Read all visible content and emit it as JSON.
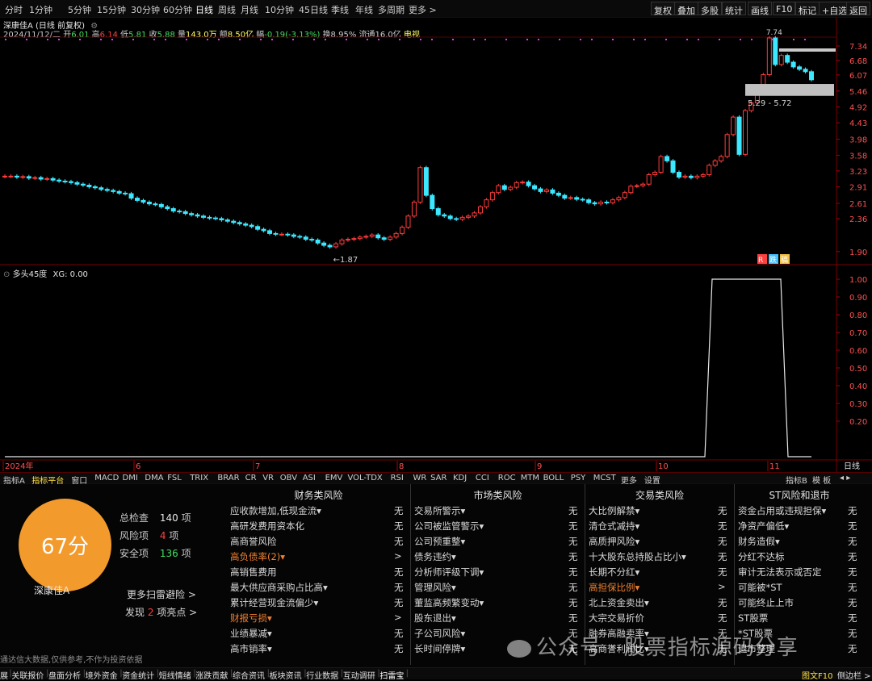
{
  "toolbar": {
    "timeframes": [
      "分时",
      "1分钟",
      "5分钟",
      "15分钟",
      "30分钟",
      "60分钟",
      "日线",
      "周线",
      "月线",
      "10分钟",
      "45日线",
      "季线",
      "年线",
      "多周期",
      "更多 >"
    ],
    "right_buttons": [
      "复权",
      "叠加",
      "多股",
      "统计",
      "画线",
      "F10",
      "标记",
      "+自选",
      "返回"
    ]
  },
  "info": {
    "name": "深康佳A (日线 前复权)",
    "date": "2024/11/12/二",
    "open_label": "开",
    "open": "6.01",
    "high_label": "高",
    "high": "6.14",
    "low_label": "低",
    "low": "5.81",
    "close_label": "收",
    "close": "5.88",
    "volume_label": "量",
    "volume": "143.0万",
    "amount_label": "额",
    "amount": "8.50亿",
    "change_label": "幅",
    "change": "-0.19(-3.13%)",
    "turnover_label": "换",
    "turnover": "8.95%",
    "float_label": "流通",
    "float": "16.0亿",
    "sector": "电视"
  },
  "price_axis": [
    "7.34",
    "6.68",
    "6.07",
    "5.46",
    "4.92",
    "4.43",
    "3.98",
    "3.58",
    "3.23",
    "2.91",
    "2.61",
    "2.36",
    "1.90"
  ],
  "annotations": {
    "low_price": "1.87",
    "high_price": "7.74",
    "range": "5.29 - 5.72",
    "tags": [
      "R",
      "跌",
      "稿"
    ]
  },
  "indicator": {
    "title": "多头45度",
    "value": "XG: 0.00",
    "axis": [
      "1.00",
      "0.90",
      "0.80",
      "0.70",
      "0.60",
      "0.50",
      "0.40",
      "0.30",
      "0.20"
    ]
  },
  "time_axis": {
    "labels": [
      "2024年",
      "6",
      "7",
      "8",
      "9",
      "10",
      "11"
    ],
    "right_label": "日线"
  },
  "indicator_tabs": [
    "指标A",
    "指标平台",
    "窗口",
    "MACD",
    "DMI",
    "DMA",
    "FSL",
    "TRIX",
    "BRAR",
    "CR",
    "VR",
    "OBV",
    "ASI",
    "EMV",
    "VOL-TDX",
    "RSI",
    "WR",
    "SAR",
    "KDJ",
    "CCI",
    "ROC",
    "MTM",
    "BOLL",
    "PSY",
    "MCST",
    "更多",
    "设置"
  ],
  "indicator_tabs_right": [
    "指标B",
    "模 板"
  ],
  "scan": {
    "score": "67分",
    "stock_name": "深康佳A",
    "total_label": "总检查",
    "total": "140",
    "total_unit": "项",
    "risk_label": "风险项",
    "risk": "4",
    "risk_unit": "项",
    "safe_label": "安全项",
    "safe": "136",
    "safe_unit": "项",
    "more_link": "更多扫雷避险 >",
    "found_prefix": "发现",
    "found": "2",
    "found_suffix": "项亮点 >",
    "disclaimer": "通达信大数据,仅供参考,不作为投资依据"
  },
  "categories": [
    {
      "title": "财务类风险",
      "rows": [
        {
          "label": "应收款增加,低现金流▾",
          "value": "无",
          "hl": false
        },
        {
          "label": "高研发费用资本化",
          "value": "无",
          "hl": false
        },
        {
          "label": "高商誉风险",
          "value": "无",
          "hl": false
        },
        {
          "label": "高负债率(2)▾",
          "value": ">",
          "hl": true
        },
        {
          "label": "高销售费用",
          "value": "无",
          "hl": false
        },
        {
          "label": "最大供应商采购占比高▾",
          "value": "无",
          "hl": false
        },
        {
          "label": "累计经营现金流偏少▾",
          "value": "无",
          "hl": false
        },
        {
          "label": "财报亏损▾",
          "value": ">",
          "hl": true
        },
        {
          "label": "业绩暴减▾",
          "value": "无",
          "hl": false
        },
        {
          "label": "高市销率▾",
          "value": "无",
          "hl": false
        }
      ]
    },
    {
      "title": "市场类风险",
      "rows": [
        {
          "label": "交易所警示▾",
          "value": "无",
          "hl": false
        },
        {
          "label": "公司被监管警示▾",
          "value": "无",
          "hl": false
        },
        {
          "label": "公司预重整▾",
          "value": "无",
          "hl": false
        },
        {
          "label": "债务违约▾",
          "value": "无",
          "hl": false
        },
        {
          "label": "分析师评级下调▾",
          "value": "无",
          "hl": false
        },
        {
          "label": "管理风险▾",
          "value": "无",
          "hl": false
        },
        {
          "label": "董监高频繁变动▾",
          "value": "无",
          "hl": false
        },
        {
          "label": "股东退出▾",
          "value": "无",
          "hl": false
        },
        {
          "label": "子公司风险▾",
          "value": "无",
          "hl": false
        },
        {
          "label": "长时间停牌▾",
          "value": "无",
          "hl": false
        }
      ]
    },
    {
      "title": "交易类风险",
      "rows": [
        {
          "label": "大比例解禁▾",
          "value": "无",
          "hl": false
        },
        {
          "label": "清仓式减持▾",
          "value": "无",
          "hl": false
        },
        {
          "label": "高质押风险▾",
          "value": "无",
          "hl": false
        },
        {
          "label": "十大股东总持股占比小▾",
          "value": "无",
          "hl": false
        },
        {
          "label": "长期不分红▾",
          "value": "无",
          "hl": false
        },
        {
          "label": "高担保比例▾",
          "value": ">",
          "hl": true
        },
        {
          "label": "北上资金卖出▾",
          "value": "无",
          "hl": false
        },
        {
          "label": "大宗交易折价",
          "value": "无",
          "hl": false
        },
        {
          "label": "融券高融卖率▾",
          "value": "无",
          "hl": false
        },
        {
          "label": "高商誉利润比▾",
          "value": "无",
          "hl": false
        }
      ]
    },
    {
      "title": "ST风险和退市",
      "rows": [
        {
          "label": "资金占用或违规担保▾",
          "value": "无",
          "hl": false
        },
        {
          "label": "净资产偏低▾",
          "value": "无",
          "hl": false
        },
        {
          "label": "财务造假▾",
          "value": "无",
          "hl": false
        },
        {
          "label": "分红不达标",
          "value": "无",
          "hl": false
        },
        {
          "label": "审计无法表示或否定",
          "value": "无",
          "hl": false
        },
        {
          "label": "可能被*ST",
          "value": "无",
          "hl": false
        },
        {
          "label": "可能终止上市",
          "value": "无",
          "hl": false
        },
        {
          "label": "ST股票",
          "value": "无",
          "hl": false
        },
        {
          "label": "*ST股票",
          "value": "无",
          "hl": false
        },
        {
          "label": "退市整理",
          "value": "无",
          "hl": false
        }
      ]
    }
  ],
  "bottom_tabs": [
    "展",
    "关联报价",
    "盘面分析",
    "境外资金",
    "资金统计",
    "短线情绪",
    "涨跌贡献",
    "综合资讯",
    "板块资讯",
    "行业数据",
    "互动调研",
    "扫雷宝"
  ],
  "bottom_right": [
    "图文F10",
    "侧边栏 >"
  ],
  "watermark": "公众号 · 股票指标源码分享",
  "colors": {
    "up": "#ff3c3c",
    "down": "#3ce8ff",
    "highlight": "#f08030",
    "score_bg": "#f39a2c",
    "risk": "#ff4040",
    "safe": "#40e060",
    "found": "#ff4040"
  },
  "chart_data": {
    "type": "candlestick",
    "title": "深康佳A (日线 前复权)",
    "ylim": [
      1.8,
      7.7
    ],
    "x_labels": [
      "2024年",
      "6",
      "7",
      "8",
      "9",
      "10",
      "11"
    ],
    "closes": [
      3.12,
      3.12,
      3.1,
      3.11,
      3.08,
      3.09,
      3.06,
      3.07,
      3.04,
      3.02,
      3.01,
      2.99,
      2.96,
      2.94,
      2.91,
      2.89,
      2.86,
      2.84,
      2.82,
      2.79,
      2.78,
      2.7,
      2.66,
      2.63,
      2.6,
      2.59,
      2.55,
      2.52,
      2.48,
      2.47,
      2.44,
      2.42,
      2.4,
      2.38,
      2.37,
      2.36,
      2.34,
      2.32,
      2.3,
      2.28,
      2.26,
      2.24,
      2.2,
      2.18,
      2.14,
      2.13,
      2.13,
      2.12,
      2.1,
      2.09,
      2.06,
      2.05,
      2.01,
      1.98,
      1.96,
      2.0,
      2.05,
      2.06,
      2.07,
      2.09,
      2.1,
      2.12,
      2.08,
      2.06,
      2.09,
      2.14,
      2.23,
      2.4,
      2.63,
      3.3,
      2.75,
      2.52,
      2.42,
      2.4,
      2.36,
      2.35,
      2.38,
      2.4,
      2.45,
      2.55,
      2.67,
      2.8,
      2.93,
      2.86,
      2.9,
      2.99,
      3.0,
      2.93,
      2.87,
      2.82,
      2.85,
      2.79,
      2.75,
      2.7,
      2.71,
      2.68,
      2.67,
      2.62,
      2.6,
      2.63,
      2.62,
      2.67,
      2.71,
      2.8,
      2.92,
      2.93,
      2.96,
      3.15,
      3.2,
      3.55,
      3.45,
      3.2,
      3.1,
      3.12,
      3.09,
      3.12,
      3.15,
      3.35,
      3.45,
      3.55,
      4.1,
      4.6,
      3.6,
      4.8,
      5.05,
      5.45,
      6.08,
      7.74,
      6.5,
      6.9,
      6.6,
      6.4,
      6.3,
      6.2,
      5.88
    ]
  }
}
